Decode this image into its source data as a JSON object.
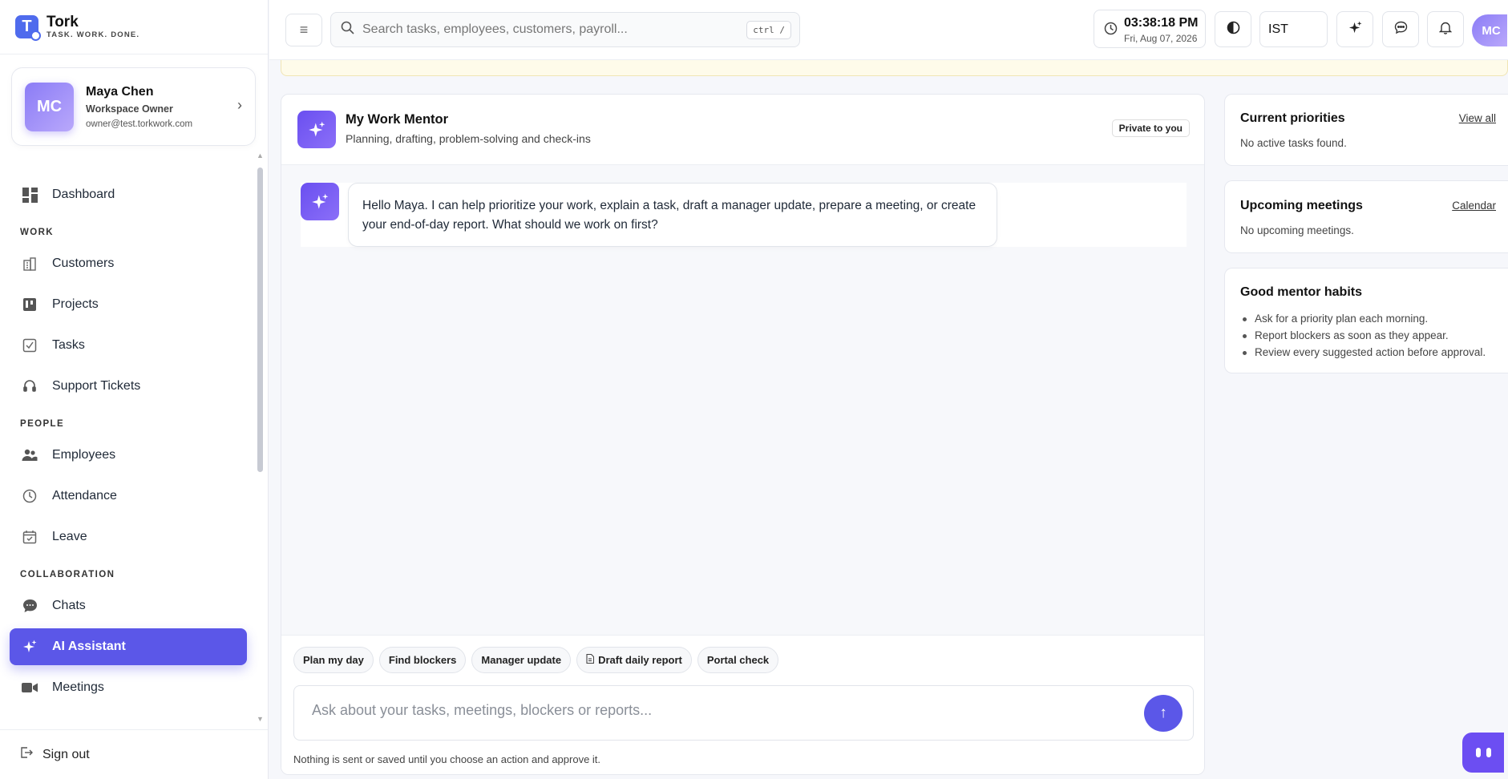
{
  "brand": {
    "name": "Tork",
    "tagline": "TASK. WORK. DONE.",
    "logo_letter": "T"
  },
  "profile": {
    "initials": "MC",
    "name": "Maya Chen",
    "role": "Workspace Owner",
    "email": "owner@test.torkwork.com"
  },
  "nav": {
    "dashboard": "Dashboard",
    "work_section": "WORK",
    "customers": "Customers",
    "projects": "Projects",
    "tasks": "Tasks",
    "support": "Support Tickets",
    "people_section": "PEOPLE",
    "employees": "Employees",
    "attendance": "Attendance",
    "leave": "Leave",
    "collab_section": "COLLABORATION",
    "chats": "Chats",
    "ai_assistant": "AI Assistant",
    "meetings": "Meetings",
    "signout": "Sign out"
  },
  "topbar": {
    "search_placeholder": "Search tasks, employees, customers, payroll...",
    "search_shortcut": "ctrl /",
    "time": "03:38:18 PM",
    "date": "Fri, Aug 07, 2026",
    "timezone": "IST",
    "user_initials": "MC"
  },
  "chat": {
    "title": "My Work Mentor",
    "subtitle": "Planning, drafting, problem-solving and check-ins",
    "privacy_badge": "Private to you",
    "message": "Hello Maya. I can help prioritize your work, explain a task, draft a manager update, prepare a meeting, or create your end-of-day report. What should we work on first?",
    "chips": [
      "Plan my day",
      "Find blockers",
      "Manager update",
      "Draft daily report",
      "Portal check"
    ],
    "input_placeholder": "Ask about your tasks, meetings, blockers or reports...",
    "disclaimer": "Nothing is sent or saved until you choose an action and approve it."
  },
  "cards": {
    "priorities": {
      "title": "Current priorities",
      "link": "View all",
      "empty": "No active tasks found."
    },
    "meetings": {
      "title": "Upcoming meetings",
      "link": "Calendar",
      "empty": "No upcoming meetings."
    },
    "habits": {
      "title": "Good mentor habits",
      "items": [
        "Ask for a priority plan each morning.",
        "Report blockers as soon as they appear.",
        "Review every suggested action before approval."
      ]
    }
  },
  "colors": {
    "accent": "#5b57e8",
    "brand": "#4f6bed",
    "banner": "#fefbea"
  }
}
